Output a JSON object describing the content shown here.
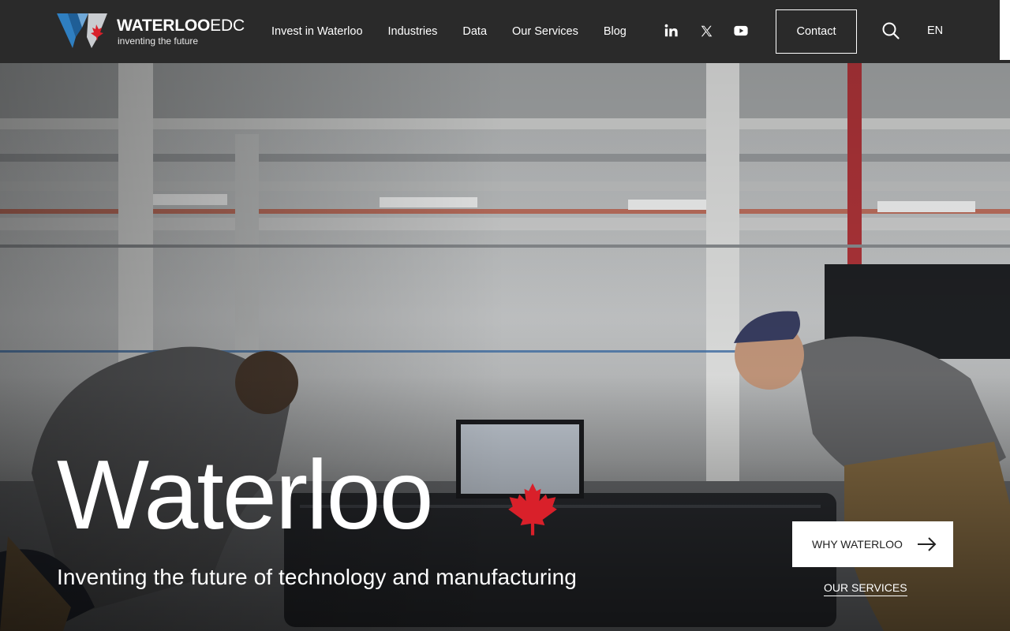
{
  "header": {
    "logo": {
      "word_bold": "WATERLOO",
      "word_light": "EDC",
      "tagline": "inventing the future"
    },
    "nav": [
      {
        "label": "Invest in Waterloo"
      },
      {
        "label": "Industries"
      },
      {
        "label": "Data"
      },
      {
        "label": "Our Services"
      },
      {
        "label": "Blog"
      }
    ],
    "social": {
      "linkedin": "linkedin-icon",
      "x": "x-icon",
      "youtube": "youtube-icon"
    },
    "contact_label": "Contact",
    "search_icon": "search-icon",
    "language": "EN"
  },
  "hero": {
    "title": "Waterloo",
    "subtitle": "Inventing the future of technology and manufacturing",
    "primary_cta": "WHY WATERLOO",
    "secondary_cta": "OUR SERVICES",
    "accent_color": "#d9202a"
  }
}
